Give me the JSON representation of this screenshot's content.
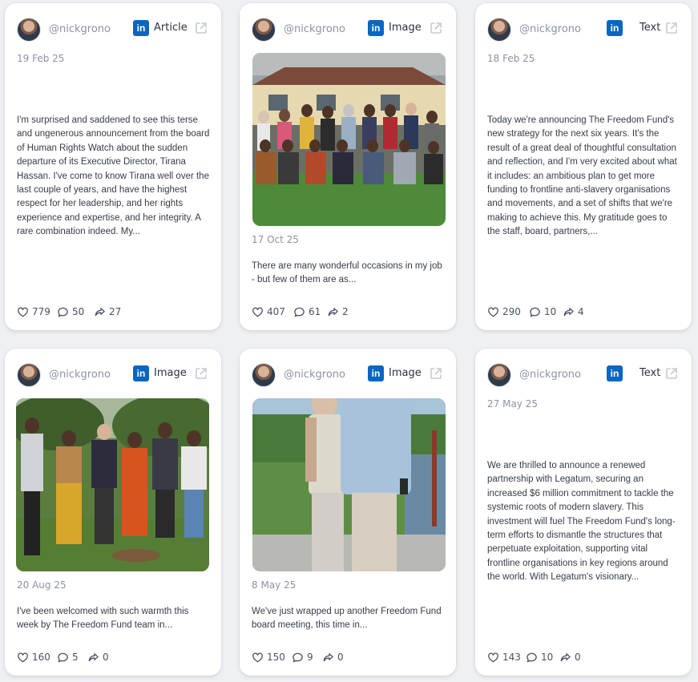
{
  "posts": [
    {
      "handle": "@nickgrono",
      "type_label": "Article",
      "date": "19 Feb 25",
      "text": "I'm surprised and saddened to see this terse and ungenerous announcement from the board of Human Rights Watch about the sudden departure of its Executive Director, Tirana Hassan. I've come to know Tirana well over the last couple of years, and have the highest respect for her leadership, and her rights experience and expertise, and her integrity. A rare combination indeed. My...",
      "likes": "779",
      "comments": "50",
      "shares": "27"
    },
    {
      "handle": "@nickgrono",
      "type_label": "Image",
      "date": "17 Oct 25",
      "text": "There are many wonderful occasions in my job - but few of them are as...",
      "likes": "407",
      "comments": "61",
      "shares": "2"
    },
    {
      "handle": "@nickgrono",
      "type_label": "Text",
      "date": "18 Feb 25",
      "text": "Today we're announcing The Freedom Fund's new strategy for the next six years. It's the result of a great deal of thoughtful consultation and reflection, and I'm very excited about what it includes: an ambitious plan to get more funding to frontline anti-slavery organisations and movements, and a set of shifts that we're making to achieve this. My gratitude goes to the staff, board, partners,...",
      "likes": "290",
      "comments": "10",
      "shares": "4"
    },
    {
      "handle": "@nickgrono",
      "type_label": "Image",
      "date": "20 Aug 25",
      "text": "I've been welcomed with such warmth this week by The Freedom Fund team in...",
      "likes": "160",
      "comments": "5",
      "shares": "0"
    },
    {
      "handle": "@nickgrono",
      "type_label": "Image",
      "date": "8 May 25",
      "text": "We've just wrapped up another Freedom Fund board meeting, this time in...",
      "likes": "150",
      "comments": "9",
      "shares": "0"
    },
    {
      "handle": "@nickgrono",
      "type_label": "Text",
      "date": "27 May 25",
      "text": "We are thrilled to announce a renewed partnership with Legatum, securing an increased $6 million commitment to tackle the systemic roots of modern slavery. This investment will fuel The Freedom Fund's long-term efforts to dismantle the structures that perpetuate exploitation, supporting vital frontline organisations in key regions around the world. With Legatum's visionary...",
      "likes": "143",
      "comments": "10",
      "shares": "0"
    }
  ],
  "icons": {
    "platform": "linkedin-icon",
    "external": "external-link-icon",
    "like": "heart-icon",
    "comment": "comment-icon",
    "share": "share-icon"
  },
  "colors": {
    "linkedin": "#0a66c2",
    "background": "#eef0f4",
    "card": "#ffffff",
    "muted_text": "#8a93a3"
  }
}
